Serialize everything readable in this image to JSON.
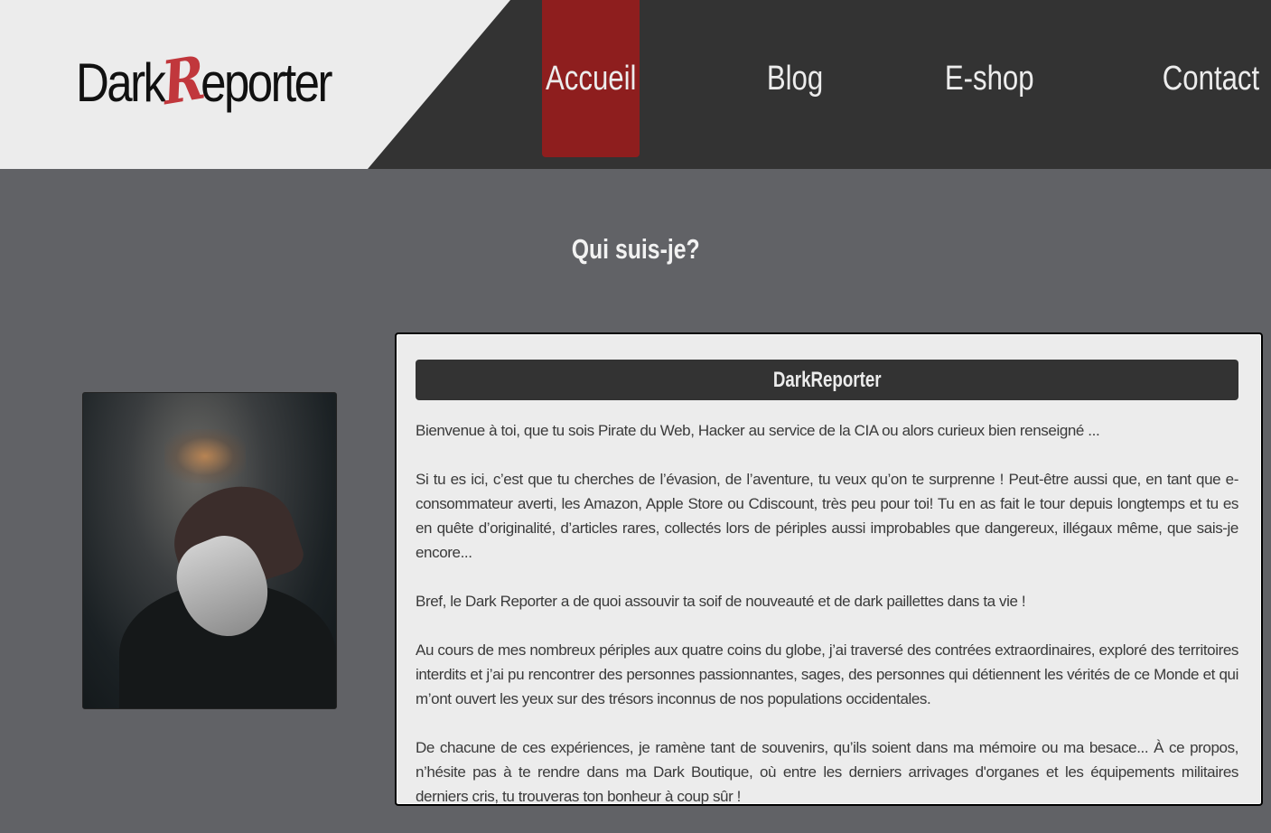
{
  "brand": {
    "logo_prefix": "Dark",
    "logo_letter": "R",
    "logo_suffix": "eporter",
    "colors": {
      "accent": "#8e1e1e",
      "logo_r": "#c1373c",
      "header_bg": "#333333",
      "page_bg": "#616266",
      "panel_bg": "#ececec"
    }
  },
  "nav": {
    "items": [
      {
        "label": "Accueil",
        "active": true
      },
      {
        "label": "Blog",
        "active": false
      },
      {
        "label": "E-shop",
        "active": false
      },
      {
        "label": "Contact",
        "active": false
      }
    ]
  },
  "main": {
    "section_title": "Qui suis-je?",
    "card": {
      "title": "DarkReporter",
      "paragraphs": [
        "Bienvenue à toi, que tu sois Pirate du Web, Hacker au service de la CIA ou alors curieux bien renseigné ...",
        "Si tu es ici, c’est que tu cherches de l’évasion, de l’aventure, tu veux qu’on te surprenne ! Peut-être aussi que, en tant que e-consommateur averti, les Amazon, Apple Store ou Cdiscount, très peu pour toi! Tu en as fait le tour depuis longtemps et tu es en quête d’originalité, d’articles rares, collectés lors de périples aussi improbables que dangereux, illégaux même, que sais-je encore...",
        "Bref, le Dark Reporter a de quoi assouvir ta soif de nouveauté et de dark paillettes dans ta vie !",
        "Au cours de mes nombreux périples aux quatre coins du globe, j’ai traversé des contrées extraordinaires, exploré des territoires interdits et j’ai pu rencontrer des personnes passionnantes, sages, des personnes qui détiennent les vérités de ce Monde et qui m’ont ouvert les yeux sur des trésors inconnus de nos populations occidentales.",
        "De chacune de ces expériences, je ramène tant de souvenirs, qu’ils soient dans ma mémoire ou ma besace... À ce propos, n’hésite pas à te rendre dans ma Dark Boutique, où entre les derniers arrivages d'organes et les équipements militaires derniers cris, tu trouveras ton bonheur à coup sûr !"
      ]
    }
  }
}
